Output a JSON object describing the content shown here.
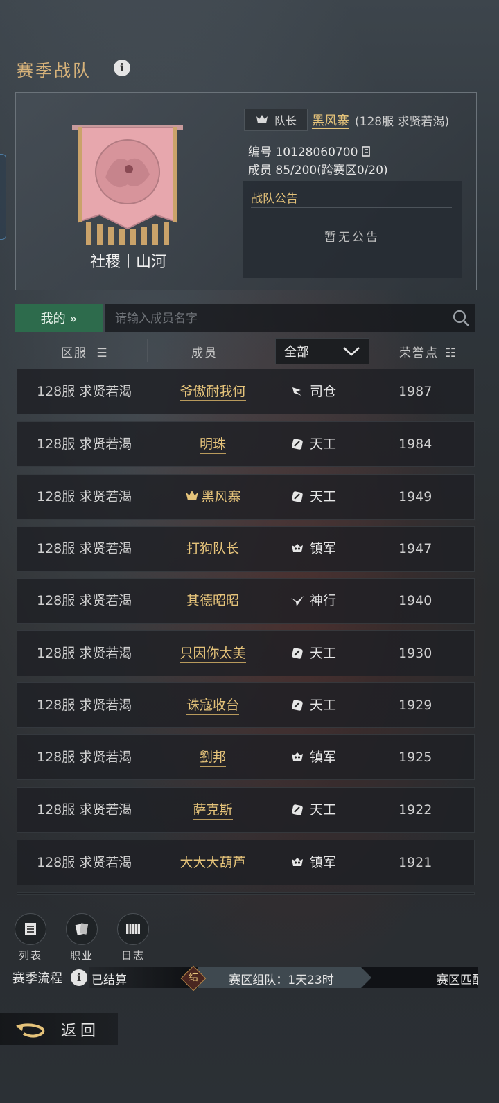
{
  "header": {
    "title": "赛季战队",
    "info_icon": "i"
  },
  "team": {
    "name": "社稷丨山河",
    "leader_label": "队长",
    "leader_name": "黑风寨",
    "leader_server": "(128服 求贤若渴)",
    "id_text": "编号 10128060700",
    "members_text": "成员 85/200(跨赛区0/20)",
    "notice_title": "战队公告",
    "notice_body": "暂无公告"
  },
  "search": {
    "mine_label": "我的 »",
    "placeholder": "请输入成员名字"
  },
  "columns": {
    "server": "区服",
    "member": "成员",
    "filter_value": "全部",
    "score": "荣誉点"
  },
  "rows": [
    {
      "server": "128服 求贤若渴",
      "name": "爷傲耐我何",
      "job": "司仓",
      "job_icon": "sicang-icon",
      "score": "1987",
      "leader": false
    },
    {
      "server": "128服 求贤若渴",
      "name": "明珠",
      "job": "天工",
      "job_icon": "tiangong-icon",
      "score": "1984",
      "leader": false
    },
    {
      "server": "128服 求贤若渴",
      "name": "黑风寨",
      "job": "天工",
      "job_icon": "tiangong-icon",
      "score": "1949",
      "leader": true
    },
    {
      "server": "128服 求贤若渴",
      "name": "打狗队长",
      "job": "镇军",
      "job_icon": "zhenjun-icon",
      "score": "1947",
      "leader": false
    },
    {
      "server": "128服 求贤若渴",
      "name": "其德昭昭",
      "job": "神行",
      "job_icon": "shenxing-icon",
      "score": "1940",
      "leader": false
    },
    {
      "server": "128服 求贤若渴",
      "name": "只因你太美",
      "job": "天工",
      "job_icon": "tiangong-icon",
      "score": "1930",
      "leader": false
    },
    {
      "server": "128服 求贤若渴",
      "name": "诛寇收台",
      "job": "天工",
      "job_icon": "tiangong-icon",
      "score": "1929",
      "leader": false
    },
    {
      "server": "128服 求贤若渴",
      "name": "劉邦",
      "job": "镇军",
      "job_icon": "zhenjun-icon",
      "score": "1925",
      "leader": false
    },
    {
      "server": "128服 求贤若渴",
      "name": "萨克斯",
      "job": "天工",
      "job_icon": "tiangong-icon",
      "score": "1922",
      "leader": false
    },
    {
      "server": "128服 求贤若渴",
      "name": "大大大葫芦",
      "job": "镇军",
      "job_icon": "zhenjun-icon",
      "score": "1921",
      "leader": false
    }
  ],
  "toolbar": {
    "list": "列表",
    "job": "职业",
    "log": "日志"
  },
  "season": {
    "label": "赛季流程",
    "stage_done": "已结算",
    "marker": "结",
    "stage_current": "赛区组队：1天23时",
    "stage_next": "赛区匹配"
  },
  "back_label": "返回",
  "colors": {
    "gold": "#e5c37a",
    "green": "#2d6b4c",
    "banner": "#e7a7ad"
  }
}
